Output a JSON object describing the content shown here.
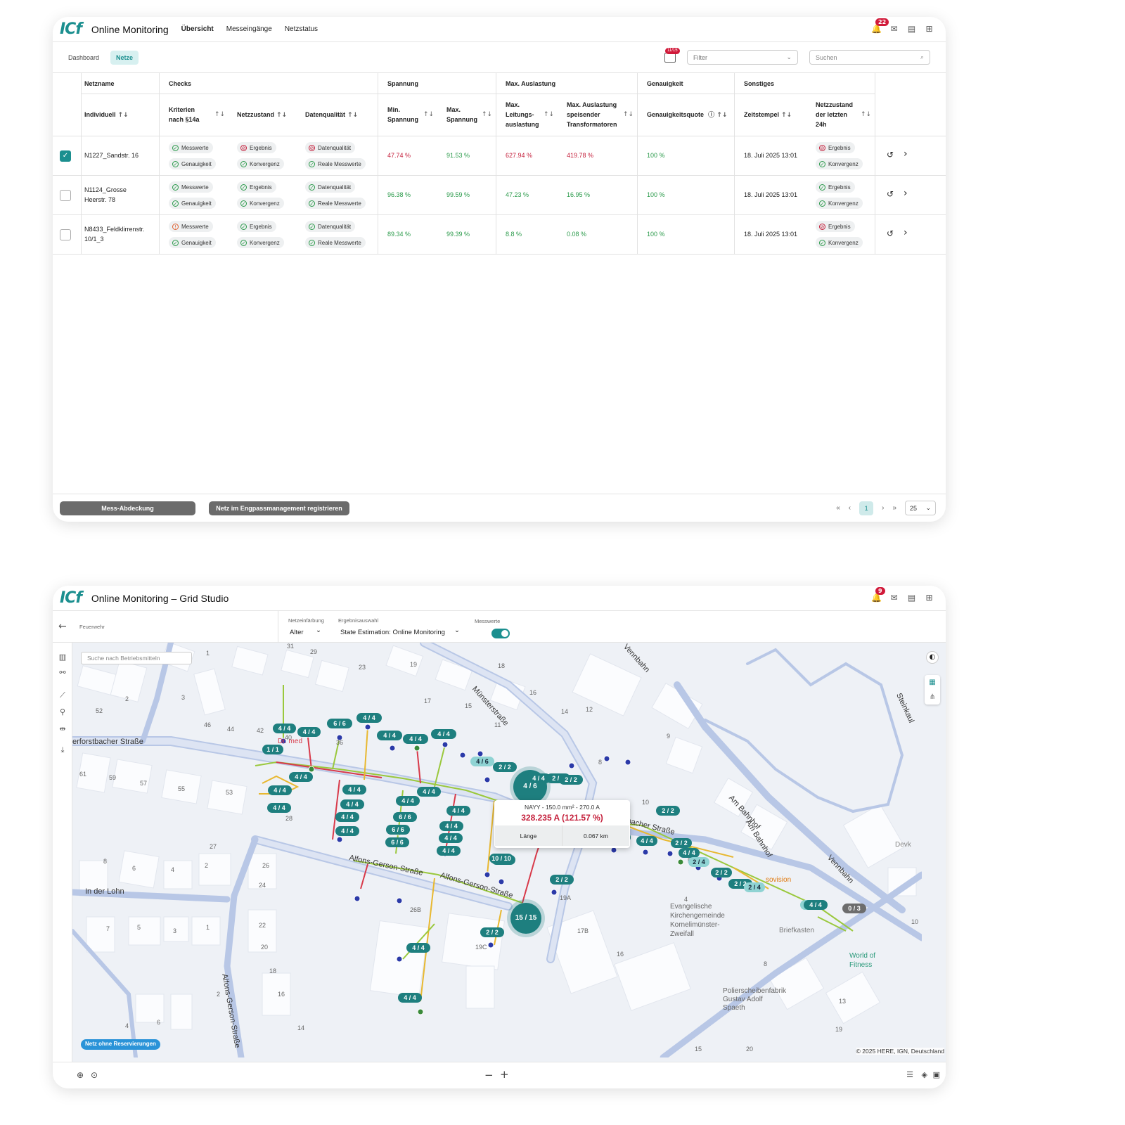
{
  "top": {
    "logo": "ICf",
    "app_title": "Online Monitoring",
    "nav": [
      "Übersicht",
      "Messeingänge",
      "Netzstatus"
    ],
    "notifications": "22"
  },
  "sub": {
    "tabs": [
      "Dashboard",
      "Netze"
    ],
    "cal_badge": "11/15",
    "filter_placeholder": "Filter",
    "search_placeholder": "Suchen"
  },
  "groups": [
    "Netzname",
    "Checks",
    "Spannung",
    "Max. Auslastung",
    "Genauigkeit",
    "Sonstiges"
  ],
  "columns": {
    "individuell": "Individuell",
    "kriterien": [
      "Kriterien",
      "nach §14a"
    ],
    "netzzustand": "Netzzustand",
    "datenqualitaet": "Datenqualität",
    "min_spannung": [
      "Min.",
      "Spannung"
    ],
    "max_spannung": [
      "Max.",
      "Spannung"
    ],
    "max_leitung": [
      "Max.",
      "Leitungs-",
      "auslastung"
    ],
    "max_trafo": [
      "Max. Auslastung",
      "speisender",
      "Transformatoren"
    ],
    "genauigkeitsquote": "Genauigkeitsquote",
    "zeitstempel": "Zeitstempel",
    "netzzustand24": [
      "Netzzustand",
      "der letzten",
      "24h"
    ]
  },
  "rows": [
    {
      "name": [
        "N1227_Sandstr. 16"
      ],
      "checked": true,
      "c1": [
        [
          "Messwerte",
          "ok"
        ],
        [
          "Genauigkeit",
          "ok"
        ]
      ],
      "c2": [
        [
          "Ergebnis",
          "bad"
        ],
        [
          "Konvergenz",
          "ok"
        ]
      ],
      "c3": [
        [
          "Datenqualität",
          "bad"
        ],
        [
          "Reale Messwerte",
          "ok"
        ]
      ],
      "min": "47.74 %",
      "min_c": "red",
      "max": "91.53 %",
      "max_c": "green",
      "leit": "627.94 %",
      "leit_c": "red",
      "trafo": "419.78 %",
      "trafo_c": "red",
      "gen": "100 %",
      "time": "18. Juli 2025 13:01",
      "c24": [
        [
          "Ergebnis",
          "bad"
        ],
        [
          "Konvergenz",
          "ok"
        ]
      ]
    },
    {
      "name": [
        "N1124_Grosse",
        "Heerstr. 78"
      ],
      "checked": false,
      "c1": [
        [
          "Messwerte",
          "ok"
        ],
        [
          "Genauigkeit",
          "ok"
        ]
      ],
      "c2": [
        [
          "Ergebnis",
          "ok"
        ],
        [
          "Konvergenz",
          "ok"
        ]
      ],
      "c3": [
        [
          "Datenqualität",
          "ok"
        ],
        [
          "Reale Messwerte",
          "ok"
        ]
      ],
      "min": "96.38 %",
      "min_c": "green",
      "max": "99.59 %",
      "max_c": "green",
      "leit": "47.23 %",
      "leit_c": "green",
      "trafo": "16.95 %",
      "trafo_c": "green",
      "gen": "100 %",
      "time": "18. Juli 2025 13:01",
      "c24": [
        [
          "Ergebnis",
          "ok"
        ],
        [
          "Konvergenz",
          "ok"
        ]
      ]
    },
    {
      "name": [
        "N8433_Feldklirrenstr.",
        "10/1_3"
      ],
      "checked": false,
      "c1": [
        [
          "Messwerte",
          "warn"
        ],
        [
          "Genauigkeit",
          "ok"
        ]
      ],
      "c2": [
        [
          "Ergebnis",
          "ok"
        ],
        [
          "Konvergenz",
          "ok"
        ]
      ],
      "c3": [
        [
          "Datenqualität",
          "ok"
        ],
        [
          "Reale Messwerte",
          "ok"
        ]
      ],
      "min": "89.34 %",
      "min_c": "green",
      "max": "99.39 %",
      "max_c": "green",
      "leit": "8.8 %",
      "leit_c": "green",
      "trafo": "0.08 %",
      "trafo_c": "green",
      "gen": "100 %",
      "time": "18. Juli 2025 13:01",
      "c24": [
        [
          "Ergebnis",
          "bad"
        ],
        [
          "Konvergenz",
          "ok"
        ]
      ]
    }
  ],
  "footer": {
    "btn1": "Mess-Abdeckung",
    "btn2": "Netz im Engpassmanagement registrieren",
    "page": "1",
    "per_page": "25"
  },
  "studio": {
    "title": "Online Monitoring – Grid Studio",
    "notifications": "9",
    "back_label": "Feuerwehr",
    "netzeinfaerbung_label": "Netzeinfärbung",
    "netzeinfaerbung_value": "Alter",
    "ergebnis_label": "Ergebnisauswahl",
    "ergebnis_value": "State Estimation: Online Monitoring",
    "messwerte_label": "Messwerte",
    "search_placeholder": "Suche nach Betriebsmitteln",
    "legend_badge": "Netz ohne Reservierungen",
    "copyright": "© 2025 HERE, IGN, Deutschland"
  },
  "map": {
    "streets": [
      "erforstbacher Straße",
      "Münsterstraße",
      "Alfons-Gerson-Straße",
      "Alfons-Gerson-Straße",
      "In der Lohn",
      "Alfons-Gerson-Straße",
      "Am Bahnhof",
      "Am Bahnhof",
      "Vennbahn",
      "Vennbahn",
      "erforstbacher Straße",
      "Steinkaul"
    ],
    "pois": [
      "Evangelische",
      "Kirchengemeinde",
      "Kornelimünster-",
      "Zweifall",
      "Briefkasten",
      "World of",
      "Fitness",
      "Polierscheibenfabrik",
      "Gustav Adolf",
      "Spaeth",
      "Devk",
      "Dr. med",
      "sovision"
    ],
    "numbers": [
      "31",
      "29",
      "19",
      "18",
      "23",
      "1",
      "2",
      "3",
      "52",
      "46",
      "44",
      "42",
      "40",
      "36",
      "17",
      "15",
      "16",
      "11",
      "14",
      "12",
      "9",
      "8",
      "61",
      "59",
      "57",
      "55",
      "53",
      "27",
      "26",
      "24",
      "8",
      "6",
      "4",
      "2",
      "7",
      "5",
      "3",
      "1",
      "22",
      "20",
      "18",
      "16",
      "2",
      "6",
      "4",
      "14",
      "28",
      "27",
      "26B",
      "19C",
      "19A",
      "17B",
      "16",
      "10",
      "5",
      "4",
      "8",
      "10",
      "13",
      "19",
      "20",
      "15"
    ],
    "labels": [
      [
        "4 / 4",
        ""
      ],
      [
        "4 / 4",
        ""
      ],
      [
        "6 / 6",
        ""
      ],
      [
        "4 / 4",
        ""
      ],
      [
        "4 / 4",
        ""
      ],
      [
        "4 / 4",
        ""
      ],
      [
        "4 / 4",
        ""
      ],
      [
        "1 / 1",
        ""
      ],
      [
        "4 / 4",
        ""
      ],
      [
        "4 / 4",
        ""
      ],
      [
        "4 / 4",
        ""
      ],
      [
        "4 / 4",
        ""
      ],
      [
        "4 / 4",
        ""
      ],
      [
        "4 / 4",
        ""
      ],
      [
        "4 / 4",
        ""
      ],
      [
        "4 / 4",
        ""
      ],
      [
        "6 / 6",
        ""
      ],
      [
        "6 / 6",
        ""
      ],
      [
        "6 / 6",
        ""
      ],
      [
        "4 / 4",
        ""
      ],
      [
        "4 / 4",
        ""
      ],
      [
        "4 / 4",
        ""
      ],
      [
        "4 / 4",
        ""
      ],
      [
        "4 / 4",
        ""
      ],
      [
        "4 / 6",
        "light"
      ],
      [
        "2 / 2",
        ""
      ],
      [
        "4 / 4",
        ""
      ],
      [
        "2 / 2",
        ""
      ],
      [
        "2 / 2",
        ""
      ],
      [
        "6 / 6",
        ""
      ],
      [
        "10 / 10",
        ""
      ],
      [
        "2 / 2",
        ""
      ],
      [
        "2 / 2",
        ""
      ],
      [
        "4 / 4",
        ""
      ],
      [
        "2 / 2",
        ""
      ],
      [
        "4 / 4",
        ""
      ],
      [
        "2 / 2",
        ""
      ],
      [
        "4 / 4",
        ""
      ],
      [
        "2 / 4",
        "light"
      ],
      [
        "2 / 2",
        ""
      ],
      [
        "2 / 2",
        ""
      ],
      [
        "2 / 2",
        ""
      ],
      [
        "2 / 4",
        "light"
      ],
      [
        "2 / 4",
        "light"
      ],
      [
        "4 / 4",
        ""
      ],
      [
        "0 / 3",
        "gray"
      ],
      [
        "4 / 4",
        ""
      ]
    ],
    "cluster1": "4 / 6",
    "cluster2": "15 / 15"
  },
  "tooltip": {
    "cable": "NAYY - 150.0 mm² - 270.0 A",
    "current": "328.235 A (121.57 %)",
    "length_label": "Länge",
    "length_value": "0.067 km"
  }
}
